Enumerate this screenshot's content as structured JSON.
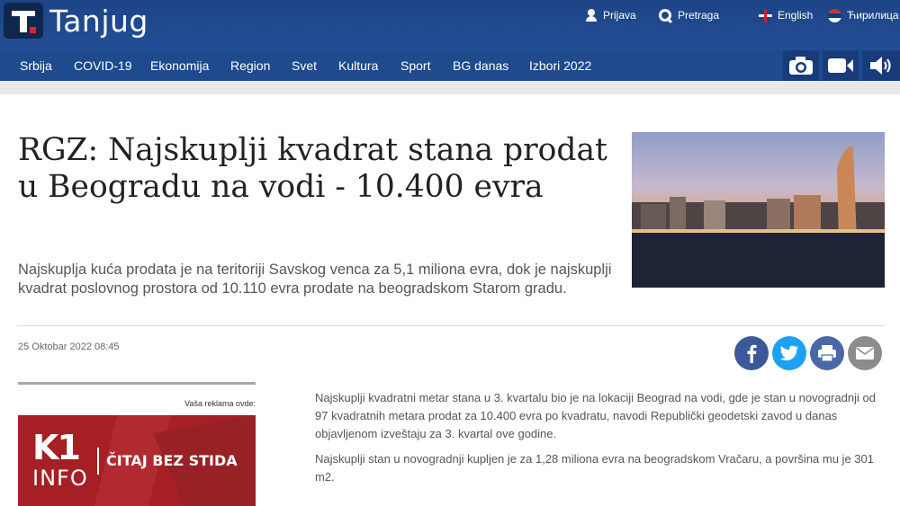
{
  "brand": {
    "name": "Tanjug"
  },
  "top_links": [
    {
      "label": "Prijava",
      "icon": "user-icon"
    },
    {
      "label": "Pretraga",
      "icon": "search-icon"
    },
    {
      "label": "English",
      "icon": "uk-flag-icon"
    },
    {
      "label": "Ћирилица",
      "icon": "serbia-flag-icon"
    }
  ],
  "nav": {
    "items": [
      "Srbija",
      "COVID-19",
      "Ekonomija",
      "Region",
      "Svet",
      "Kultura",
      "Sport",
      "BG danas",
      "Izbori 2022"
    ],
    "media": [
      "camera-icon",
      "video-icon",
      "audio-icon"
    ]
  },
  "article": {
    "title": "RGZ: Najskuplji kvadrat stana prodat u Beogradu na vodi - 10.400 evra",
    "lead": "Najskuplja kuća prodata je na teritoriji Savskog venca za 5,1 miliona evra, dok je najskuplji kvadrat poslovnog prostora od 10.110 evra prodate na beogradskom Starom gradu.",
    "date": "25 Oktobar 2022 08:45",
    "paragraphs": [
      "Najskuplji kvadratni metar stana u 3. kvartalu bio je na lokaciji Beograd na vodi, gde je stan u novogradnji od 97 kvadratnih metara prodat za 10.400 evra po kvadratu, navodi Republički geodetski zavod u danas objavljenom izveštaju za 3. kvartal ove godine.",
      "Najskuplji stan u novogradnji kupljen je za 1,28 miliona evra na beogradskom Vračaru, a površina mu je 301 m2."
    ]
  },
  "share": [
    {
      "icon": "facebook-icon",
      "color": "#3b5998",
      "label": "f"
    },
    {
      "icon": "twitter-icon",
      "color": "#1da1f2",
      "label": "t"
    },
    {
      "icon": "print-icon",
      "color": "#4a67a8",
      "label": "p"
    },
    {
      "icon": "mail-icon",
      "color": "#8c8c8c",
      "label": "m"
    }
  ],
  "ad": {
    "label": "Vaša reklama ovde:",
    "brand_top": "K1",
    "brand_bottom": "INFO",
    "slogan": "ČITAJ BEZ STIDA"
  },
  "colors": {
    "header_bg": "#1f4a8e",
    "ad_bg": "#a51f24"
  }
}
